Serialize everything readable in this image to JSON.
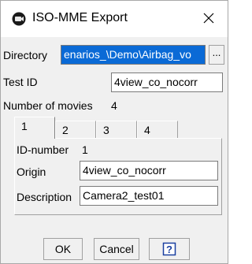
{
  "window": {
    "title": "ISO-MME Export",
    "app_icon": "camera-icon",
    "close_icon": "close-icon"
  },
  "directory": {
    "label": "Directory",
    "value": "enarios_\\Demo\\Airbag_vo",
    "browse_label": "..."
  },
  "test_id": {
    "label": "Test ID",
    "value": "4view_co_nocorr"
  },
  "movies": {
    "label": "Number of movies",
    "count": "4"
  },
  "tabs": [
    {
      "label": "1",
      "active": true
    },
    {
      "label": "2",
      "active": false
    },
    {
      "label": "3",
      "active": false
    },
    {
      "label": "4",
      "active": false
    }
  ],
  "panel": {
    "id_label": "ID-number",
    "id_value": "1",
    "origin_label": "Origin",
    "origin_value": "4view_co_nocorr",
    "description_label": "Description",
    "description_value": "Camera2_test01"
  },
  "buttons": {
    "ok": "OK",
    "cancel": "Cancel",
    "help_icon": "help-icon"
  },
  "colors": {
    "selection": "#0a6ad6",
    "dialog_bg": "#f0f0f0"
  }
}
